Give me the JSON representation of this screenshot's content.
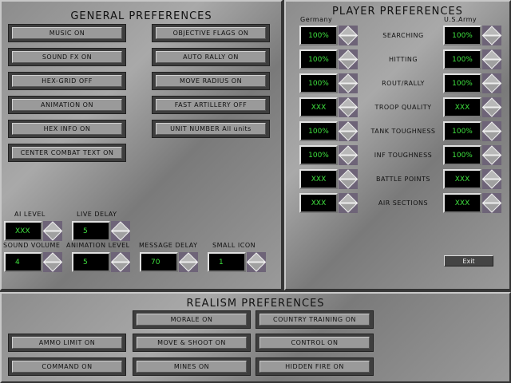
{
  "general": {
    "title": "GENERAL PREFERENCES",
    "left_buttons": [
      "MUSIC ON",
      "SOUND FX ON",
      "HEX-GRID OFF",
      "ANIMATION ON",
      "HEX INFO ON",
      "CENTER COMBAT TEXT ON"
    ],
    "right_buttons": [
      "OBJECTIVE FLAGS ON",
      "AUTO RALLY ON",
      "MOVE RADIUS ON",
      "FAST ARTILLERY OFF",
      "UNIT NUMBER All units"
    ],
    "spinners": [
      {
        "label": "AI LEVEL",
        "value": "XXX"
      },
      {
        "label": "LIVE DELAY",
        "value": "5"
      },
      {
        "label": "SOUND VOLUME",
        "value": "4"
      },
      {
        "label": "ANIMATION LEVEL",
        "value": "5"
      },
      {
        "label": "MESSAGE DELAY",
        "value": "70"
      },
      {
        "label": "SMALL ICON",
        "value": "1"
      }
    ]
  },
  "player": {
    "title": "PLAYER PREFERENCES",
    "side_a": "Germany",
    "side_b": "U.S.Army",
    "rows": [
      {
        "label": "SEARCHING",
        "a": "100%",
        "b": "100%"
      },
      {
        "label": "HITTING",
        "a": "100%",
        "b": "100%"
      },
      {
        "label": "ROUT/RALLY",
        "a": "100%",
        "b": "100%"
      },
      {
        "label": "TROOP QUALITY",
        "a": "XXX",
        "b": "XXX"
      },
      {
        "label": "TANK TOUGHNESS",
        "a": "100%",
        "b": "100%"
      },
      {
        "label": "INF TOUGHNESS",
        "a": "100%",
        "b": "100%"
      },
      {
        "label": "BATTLE POINTS",
        "a": "XXX",
        "b": "XXX"
      },
      {
        "label": "AIR SECTIONS",
        "a": "XXX",
        "b": "XXX"
      }
    ],
    "exit_label": "Exit"
  },
  "realism": {
    "title": "REALISM PREFERENCES",
    "buttons": [
      {
        "label": "MORALE ON",
        "row": 0,
        "col": 1
      },
      {
        "label": "COUNTRY TRAINING ON",
        "row": 0,
        "col": 2
      },
      {
        "label": "AMMO LIMIT ON",
        "row": 1,
        "col": 0
      },
      {
        "label": "MOVE & SHOOT ON",
        "row": 1,
        "col": 1
      },
      {
        "label": "CONTROL ON",
        "row": 1,
        "col": 2
      },
      {
        "label": "COMMAND ON",
        "row": 2,
        "col": 0
      },
      {
        "label": "MINES ON",
        "row": 2,
        "col": 1
      },
      {
        "label": "HIDDEN FIRE ON",
        "row": 2,
        "col": 2
      }
    ]
  }
}
